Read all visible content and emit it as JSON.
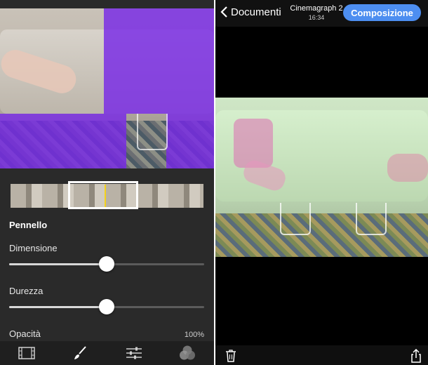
{
  "editor": {
    "section_title": "Pennello",
    "size_label": "Dimensione",
    "size_value": 0.5,
    "hardness_label": "Durezza",
    "hardness_value": 0.5,
    "opacity_label": "Opacità",
    "opacity_value": "100%",
    "toolbar_icons": [
      "film-strip-icon",
      "brush-icon",
      "sliders-icon",
      "overlay-icon"
    ]
  },
  "viewer": {
    "back_label": "Documenti",
    "title": "Cinemagraph 2",
    "time": "16:34",
    "compose_label": "Composizione",
    "bottom_icons": [
      "trash-icon",
      "share-icon"
    ]
  },
  "colors": {
    "accent_blue": "#4d8ef0",
    "mask_purple": "#7828e6",
    "timeline_cursor": "#f5d21a"
  }
}
